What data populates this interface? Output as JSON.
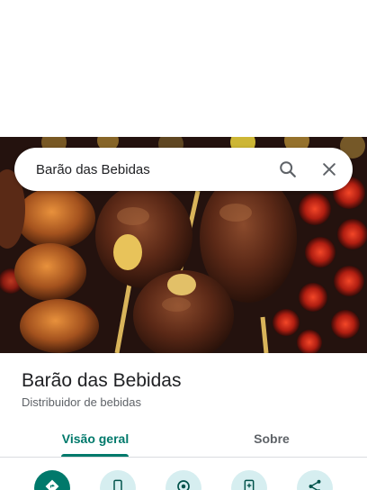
{
  "search": {
    "query": "Barão das Bebidas",
    "search_icon": "search-icon",
    "close_icon": "close-icon"
  },
  "place": {
    "title": "Barão das Bebidas",
    "category": "Distribuidor de bebidas"
  },
  "tabs": [
    {
      "label": "Visão geral",
      "selected": true
    },
    {
      "label": "Sobre",
      "selected": false
    }
  ],
  "actions": [
    {
      "icon": "directions-icon"
    },
    {
      "icon": "phone-icon"
    },
    {
      "icon": "location-icon"
    },
    {
      "icon": "save-icon"
    },
    {
      "icon": "share-icon"
    }
  ],
  "colors": {
    "accent": "#00796b",
    "action_secondary_bg": "#d6eef0"
  }
}
